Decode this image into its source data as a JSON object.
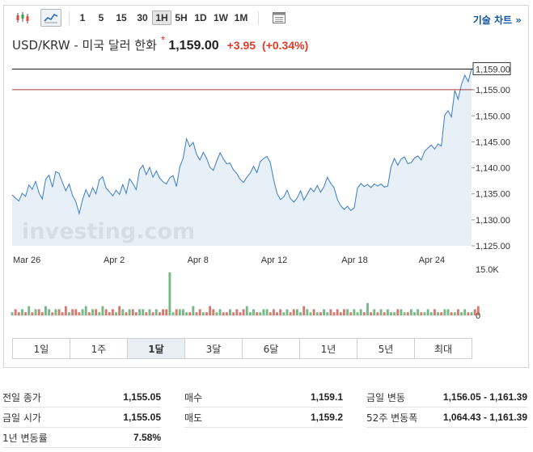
{
  "toolbar": {
    "intervals": [
      "1",
      "5",
      "15",
      "30",
      "1H",
      "5H",
      "1D",
      "1W",
      "1M"
    ],
    "active_interval": "1H",
    "technical_chart_label": "기술 차트 »"
  },
  "quote": {
    "name": "USD/KRW - 미국 달러 한화",
    "star": "*",
    "price": "1,159.00",
    "change": "+3.95",
    "change_pct": "(+0.34%)",
    "change_color": "#e23b2a"
  },
  "chart_data": {
    "type": "area",
    "watermark": "investing.com",
    "x_tick_labels": [
      "Mar 26",
      "Apr 2",
      "Apr 8",
      "Apr 12",
      "Apr 18",
      "Apr 24"
    ],
    "y_tick_labels": [
      "1,155.00",
      "1,150.00",
      "1,145.00",
      "1,140.00",
      "1,135.00",
      "1,130.00",
      "1,125.00"
    ],
    "ylim": [
      1125,
      1160
    ],
    "last_price_label": "1,159.00",
    "last_price": 1159.0,
    "reference_line": 1155.05,
    "volume_axis_max_label": "15.0K",
    "volume_axis_min_label": "0",
    "series": [
      {
        "values": [
          1134.8,
          1134.2,
          1133.6,
          1135.1,
          1134.5,
          1136.7,
          1135.9,
          1137.4,
          1135.2,
          1134.0,
          1137.8,
          1138.6,
          1136.3,
          1139.3,
          1138.9,
          1137.2,
          1135.6,
          1136.9,
          1134.7,
          1133.5,
          1131.2,
          1133.9,
          1135.8,
          1134.4,
          1136.2,
          1135.0,
          1137.7,
          1138.3,
          1136.1,
          1135.4,
          1134.6,
          1135.7,
          1134.9,
          1136.8,
          1135.1,
          1137.9,
          1137.0,
          1135.8,
          1139.6,
          1140.5,
          1138.7,
          1140.1,
          1138.2,
          1139.4,
          1138.0,
          1137.3,
          1136.9,
          1138.1,
          1138.5,
          1136.4,
          1140.2,
          1141.8,
          1145.6,
          1144.1,
          1144.9,
          1142.6,
          1141.5,
          1143.0,
          1141.8,
          1140.1,
          1139.5,
          1141.3,
          1142.9,
          1141.7,
          1140.8,
          1140.9,
          1139.6,
          1138.9,
          1137.8,
          1137.2,
          1138.2,
          1139.0,
          1140.3,
          1139.1,
          1141.2,
          1141.8,
          1142.2,
          1141.0,
          1137.7,
          1135.1,
          1133.9,
          1134.4,
          1135.7,
          1134.1,
          1133.4,
          1134.2,
          1135.6,
          1133.8,
          1134.9,
          1136.1,
          1135.4,
          1136.6,
          1135.3,
          1136.4,
          1138.2,
          1137.0,
          1136.2,
          1133.9,
          1132.7,
          1132.0,
          1132.6,
          1131.8,
          1132.3,
          1136.1,
          1137.0,
          1136.4,
          1136.8,
          1136.2,
          1136.9,
          1136.5,
          1136.9,
          1136.3,
          1136.5,
          1140.2,
          1141.8,
          1140.5,
          1141.7,
          1142.1,
          1140.8,
          1141.0,
          1141.9,
          1142.3,
          1141.5,
          1143.2,
          1143.8,
          1144.4,
          1143.6,
          1144.6,
          1144.2,
          1150.1,
          1151.0,
          1149.8,
          1154.9,
          1153.2,
          1156.1,
          1157.8,
          1156.6,
          1159.0
        ]
      }
    ],
    "volume": [
      1,
      2,
      1,
      2,
      1,
      3,
      1,
      2,
      2,
      1,
      3,
      2,
      1,
      2,
      2,
      1,
      3,
      1,
      2,
      2,
      1,
      2,
      3,
      1,
      2,
      2,
      1,
      3,
      2,
      1,
      2,
      1,
      3,
      2,
      1,
      2,
      2,
      1,
      2,
      2,
      1,
      2,
      1,
      2,
      1,
      2,
      2,
      14,
      1,
      2,
      2,
      2,
      1,
      1,
      3,
      1,
      2,
      1,
      1,
      3,
      2,
      1,
      2,
      1,
      1,
      2,
      1,
      2,
      1,
      2,
      3,
      1,
      2,
      1,
      1,
      2,
      2,
      1,
      2,
      1,
      2,
      1,
      2,
      1,
      2,
      2,
      1,
      3,
      2,
      1,
      2,
      1,
      1,
      2,
      1,
      2,
      1,
      2,
      1,
      2,
      2,
      1,
      2,
      1,
      2,
      1,
      4,
      1,
      2,
      1,
      2,
      1,
      2,
      1,
      1,
      2,
      2,
      1,
      1,
      2,
      1,
      2,
      1,
      1,
      2,
      1,
      2,
      1,
      1,
      2,
      2,
      1,
      1,
      2,
      1,
      2,
      1,
      1,
      2,
      3
    ],
    "line_color": "#3b7cc4",
    "fill_color": "#e3ecf6",
    "reference_line_color": "#a33a3a",
    "volume_up_color": "#55a868",
    "volume_down_color": "#c85a4d",
    "grid": false
  },
  "ranges": {
    "items": [
      "1일",
      "1주",
      "1달",
      "3달",
      "6달",
      "1년",
      "5년",
      "최대"
    ],
    "active": "1달"
  },
  "stats": {
    "col1": [
      {
        "label": "전일 종가",
        "value": "1,155.05"
      },
      {
        "label": "금일 시가",
        "value": "1,155.05"
      },
      {
        "label": "1년 변동률",
        "value": "7.58%"
      }
    ],
    "col2": [
      {
        "label": "매수",
        "value": "1,159.1"
      },
      {
        "label": "매도",
        "value": "1,159.2"
      }
    ],
    "col3": [
      {
        "label": "금일 변동",
        "value": "1,156.05 - 1,161.39"
      },
      {
        "label": "52주 변동폭",
        "value": "1,064.43 - 1,161.39"
      }
    ]
  }
}
